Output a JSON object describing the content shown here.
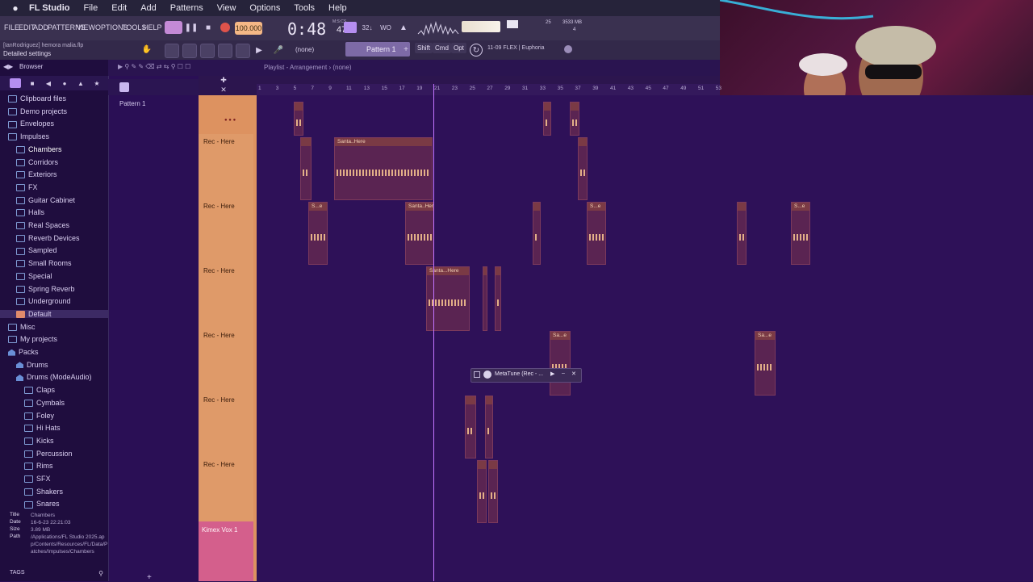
{
  "macmenu": {
    "app": "FL Studio",
    "items": [
      "File",
      "Edit",
      "Add",
      "Patterns",
      "View",
      "Options",
      "Tools",
      "Help"
    ]
  },
  "fl": {
    "menu": [
      "FILE",
      "EDIT",
      "ADD",
      "PATTERNS",
      "VIEW",
      "OPTIONS",
      "TOOLS",
      "HELP"
    ],
    "hint1": "[IanRodriguez] hemora malia.flp",
    "hint2": "Detailed settings",
    "tempo": "100.000",
    "time": "0:48",
    "time_ms": "47",
    "time_unit": "M:S:CS",
    "cpu": "25",
    "mem": "3533 MB",
    "voices": "4",
    "pattern": "Pattern 1",
    "none_label": "(none)",
    "keys": [
      "Shift",
      "Cmd",
      "Opt"
    ],
    "hint_line": "11-09 FLEX | Euphoria"
  },
  "browser": {
    "title": "Browser",
    "items": [
      {
        "label": "Clipboard files",
        "indent": 1,
        "type": "folder"
      },
      {
        "label": "Demo projects",
        "indent": 1,
        "type": "folder"
      },
      {
        "label": "Envelopes",
        "indent": 1,
        "type": "folder"
      },
      {
        "label": "Impulses",
        "indent": 1,
        "type": "folder-open"
      },
      {
        "label": "Chambers",
        "indent": 2,
        "type": "folder",
        "highlight": true
      },
      {
        "label": "Corridors",
        "indent": 2,
        "type": "folder"
      },
      {
        "label": "Exteriors",
        "indent": 2,
        "type": "folder"
      },
      {
        "label": "FX",
        "indent": 2,
        "type": "folder"
      },
      {
        "label": "Guitar Cabinet",
        "indent": 2,
        "type": "folder"
      },
      {
        "label": "Halls",
        "indent": 2,
        "type": "folder"
      },
      {
        "label": "Real Spaces",
        "indent": 2,
        "type": "folder"
      },
      {
        "label": "Reverb Devices",
        "indent": 2,
        "type": "folder"
      },
      {
        "label": "Sampled",
        "indent": 2,
        "type": "folder"
      },
      {
        "label": "Small Rooms",
        "indent": 2,
        "type": "folder"
      },
      {
        "label": "Special",
        "indent": 2,
        "type": "folder"
      },
      {
        "label": "Spring Reverb",
        "indent": 2,
        "type": "folder"
      },
      {
        "label": "Underground",
        "indent": 2,
        "type": "folder"
      },
      {
        "label": "Default",
        "indent": 2,
        "type": "file",
        "selected": true
      },
      {
        "label": "Misc",
        "indent": 1,
        "type": "folder"
      },
      {
        "label": "My projects",
        "indent": 1,
        "type": "folder"
      },
      {
        "label": "Packs",
        "indent": 1,
        "type": "box"
      },
      {
        "label": "Drums",
        "indent": 2,
        "type": "box"
      },
      {
        "label": "Drums (ModeAudio)",
        "indent": 2,
        "type": "box"
      },
      {
        "label": "Claps",
        "indent": 3,
        "type": "folder"
      },
      {
        "label": "Cymbals",
        "indent": 3,
        "type": "folder"
      },
      {
        "label": "Foley",
        "indent": 3,
        "type": "folder"
      },
      {
        "label": "Hi Hats",
        "indent": 3,
        "type": "folder"
      },
      {
        "label": "Kicks",
        "indent": 3,
        "type": "folder"
      },
      {
        "label": "Percussion",
        "indent": 3,
        "type": "folder"
      },
      {
        "label": "Rims",
        "indent": 3,
        "type": "folder"
      },
      {
        "label": "SFX",
        "indent": 3,
        "type": "folder"
      },
      {
        "label": "Shakers",
        "indent": 3,
        "type": "folder"
      },
      {
        "label": "Snares",
        "indent": 3,
        "type": "folder"
      }
    ],
    "info": {
      "title_k": "Title",
      "title_v": "Chambers",
      "date_k": "Date",
      "date_v": "16-6-23 22:21:03",
      "size_k": "Size",
      "size_v": "3.89 MB",
      "path_k": "Path",
      "path_v": "/Applications/FL Studio 2025.app/Contents/Resources/FL/Data/Patches/Impulses/Chambers"
    },
    "tags": "TAGS"
  },
  "patterns": {
    "pattern1": "Pattern 1"
  },
  "playlist": {
    "title": "Playlist - Arrangement › (none)",
    "ruler": [
      "1",
      "3",
      "5",
      "7",
      "9",
      "11",
      "13",
      "15",
      "17",
      "19",
      "21",
      "23",
      "25",
      "27",
      "29",
      "31",
      "33",
      "35",
      "37",
      "39",
      "41",
      "43",
      "45",
      "47",
      "49",
      "51",
      "53"
    ],
    "tracks": [
      {
        "label": "Rec - Here"
      },
      {
        "label": "Rec - Here"
      },
      {
        "label": "Rec - Here"
      },
      {
        "label": "Rec - Here"
      },
      {
        "label": "Rec - Here"
      },
      {
        "label": "Rec - Here"
      }
    ],
    "clip_santa": "Santa..Here",
    "clip_santa2": "Santa...Here",
    "clip_s": "S...e",
    "clip_sa": "Sa...e",
    "pink_track": "Kimex Vox 1",
    "metatune": "MetaTune (Rec - ..."
  }
}
